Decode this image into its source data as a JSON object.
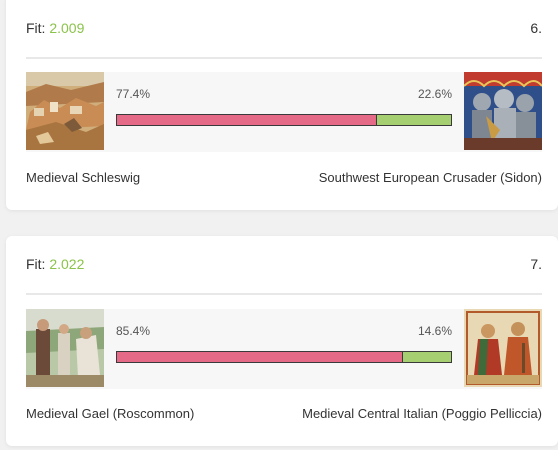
{
  "colors": {
    "fit_value": "#8bc34a",
    "left_share": "#e56a87",
    "right_share": "#a6cf72"
  },
  "results": [
    {
      "fit_label": "Fit:",
      "fit_value": "2.009",
      "rank": "6.",
      "left": {
        "name": "Medieval Schleswig",
        "percent_text": "77.4%",
        "share": 0.774,
        "image": "medieval-town-painting"
      },
      "right": {
        "name": "Southwest European Crusader (Sidon)",
        "percent_text": "22.6%",
        "share": 0.226,
        "image": "crusader-knights-manuscript"
      }
    },
    {
      "fit_label": "Fit:",
      "fit_value": "2.022",
      "rank": "7.",
      "left": {
        "name": "Medieval Gael (Roscommon)",
        "percent_text": "85.4%",
        "share": 0.854,
        "image": "gaelic-figures-painting"
      },
      "right": {
        "name": "Medieval Central Italian (Poggio Pelliccia)",
        "percent_text": "14.6%",
        "share": 0.146,
        "image": "italian-manuscript-figures"
      }
    }
  ]
}
